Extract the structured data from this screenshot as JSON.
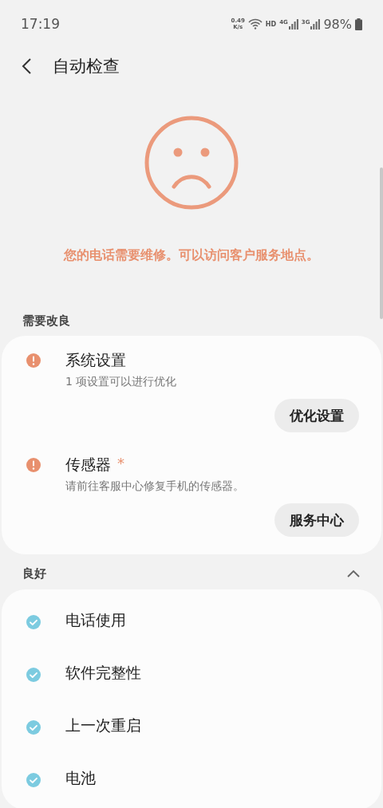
{
  "status_bar": {
    "time": "17:19",
    "speed_value": "0.49",
    "speed_unit": "K/s",
    "hd": "HD",
    "network_1": "4G",
    "network_2": "3G",
    "battery": "98%"
  },
  "header": {
    "title": "自动检查"
  },
  "result": {
    "message": "您的电话需要维修。可以访问客户服务地点。"
  },
  "sections": [
    {
      "title": "需要改良",
      "items": [
        {
          "kind": "warning",
          "title": "系统设置",
          "subtitle": "1 项设置可以进行优化",
          "action": "优化设置"
        },
        {
          "kind": "warning",
          "title": "传感器",
          "marker": "*",
          "subtitle": "请前往客服中心修复手机的传感器。",
          "action": "服务中心"
        }
      ]
    },
    {
      "title": "良好",
      "expanded": true,
      "items": [
        {
          "kind": "ok",
          "title": "电话使用"
        },
        {
          "kind": "ok",
          "title": "软件完整性"
        },
        {
          "kind": "ok",
          "title": "上一次重启"
        },
        {
          "kind": "ok",
          "title": "电池"
        }
      ]
    }
  ]
}
